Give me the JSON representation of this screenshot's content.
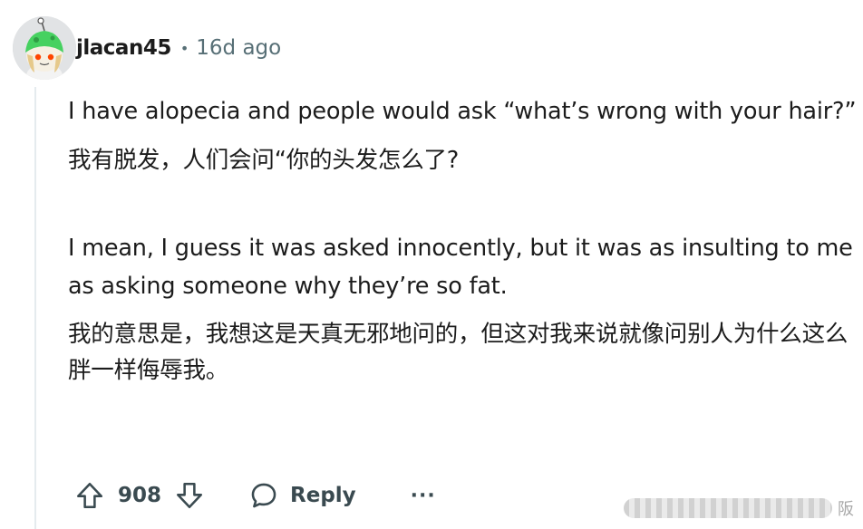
{
  "comment": {
    "username": "jlacan45",
    "separator": "•",
    "time": "16d ago",
    "paragraphs": [
      "I have alopecia and people would ask “what’s wrong with your hair?”",
      "我有脱发，人们会问“你的头发怎么了?",
      "I mean, I guess it was asked innocently, but it was as insulting to me as asking someone why they’re so fat.",
      "我的意思是，我想这是天真无邪地问的，但这对我来说就像问别人为什么这么胖一样侮辱我。"
    ]
  },
  "actions": {
    "upvote_icon": "arrow-up-icon",
    "vote_count": "908",
    "downvote_icon": "arrow-down-icon",
    "reply_icon": "speech-bubble-icon",
    "reply_label": "Reply",
    "more_label": "···"
  },
  "watermark": {
    "text": "阪"
  },
  "colors": {
    "text": "#1c1c1c",
    "meta": "#576f76",
    "action": "#3a4a50",
    "thread_line": "#e5ebee",
    "avatar_green": "#46d160"
  }
}
